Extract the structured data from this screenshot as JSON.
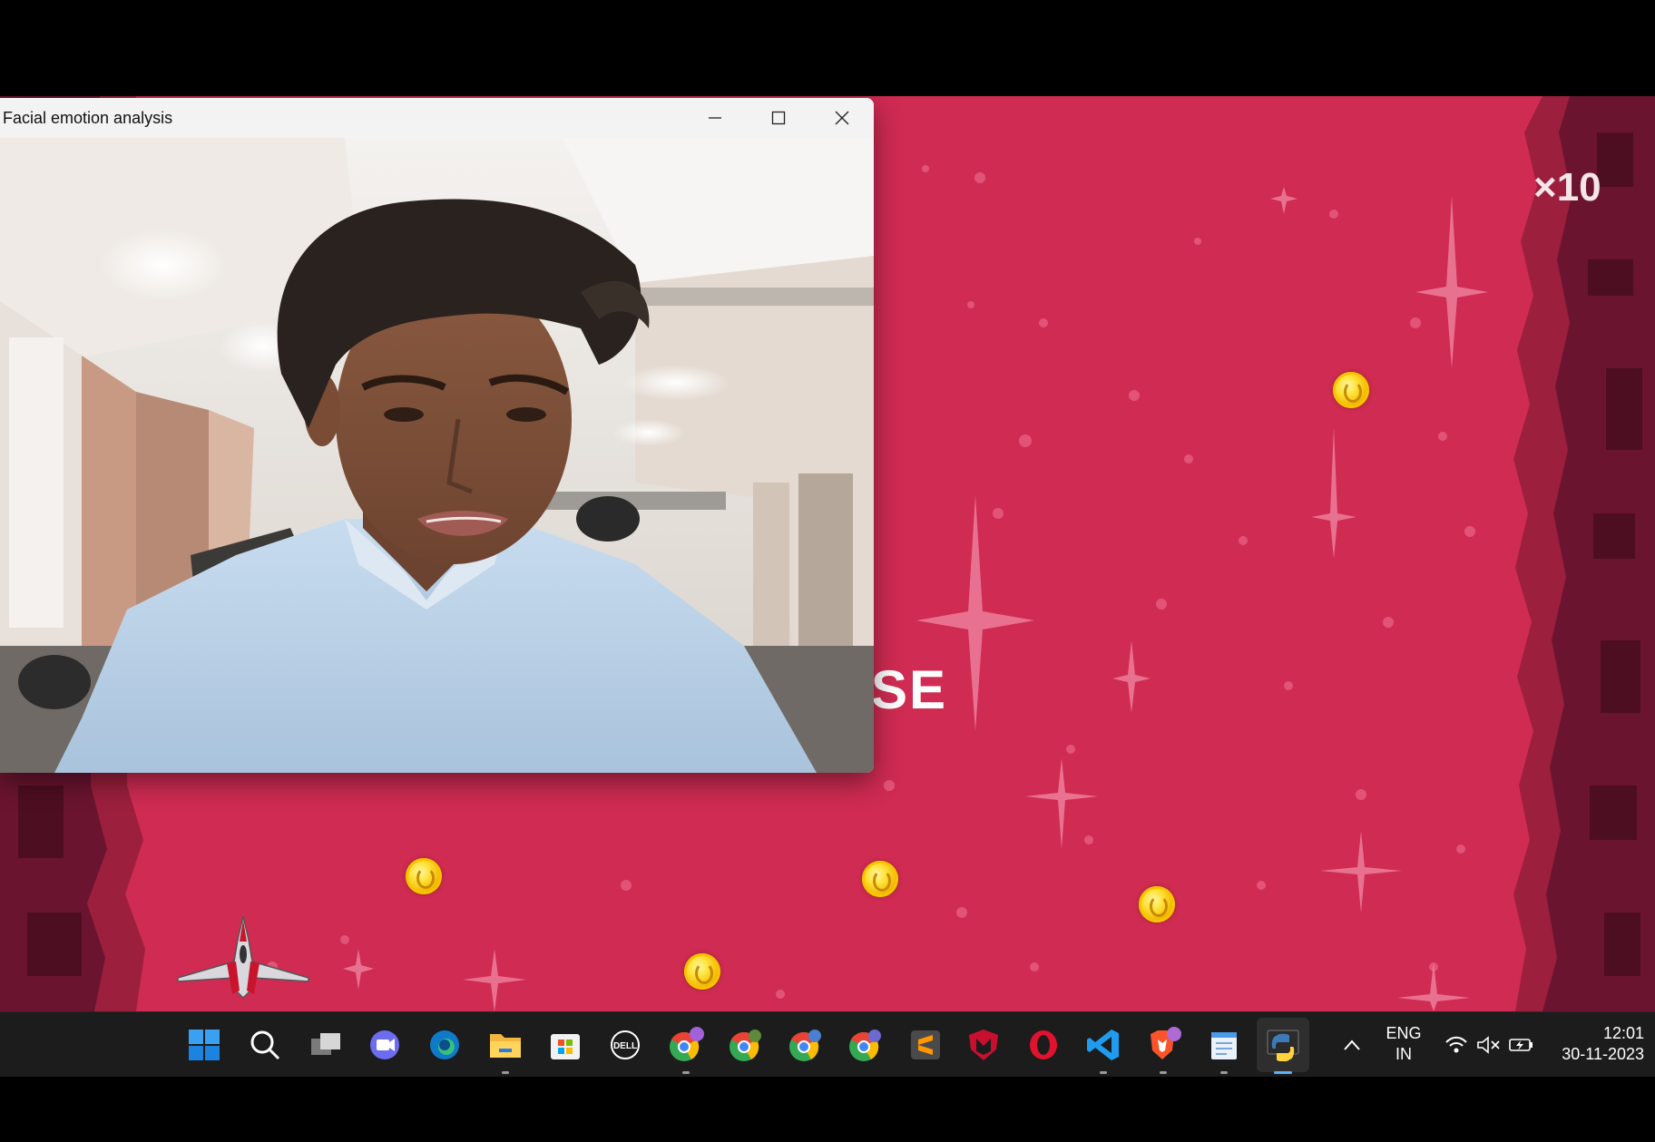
{
  "camera_window": {
    "title": "Facial emotion analysis",
    "controls": [
      "minimize",
      "maximize",
      "close"
    ]
  },
  "game": {
    "overlay_text": "SE",
    "hud_text": "×10",
    "colors": {
      "background": "#d02b52",
      "wall_dark": "#6b1430",
      "wall_mid": "#9c1f3e"
    },
    "coins_visible": 5
  },
  "taskbar": {
    "icons": [
      "windows-start-icon",
      "search-icon",
      "task-view-icon",
      "teams-chat-icon",
      "edge-icon",
      "file-explorer-icon",
      "microsoft-store-icon",
      "dell-icon",
      "chrome-profile-1-icon",
      "chrome-profile-2-icon",
      "chrome-profile-3-icon",
      "chrome-profile-4-icon",
      "sublime-text-icon",
      "mcafee-icon",
      "opera-icon",
      "vscode-icon",
      "brave-icon",
      "notepad-icon",
      "python-icon"
    ],
    "tray": {
      "language": "ENG",
      "region": "IN",
      "time": "12:01",
      "date": "30-11-2023"
    }
  }
}
